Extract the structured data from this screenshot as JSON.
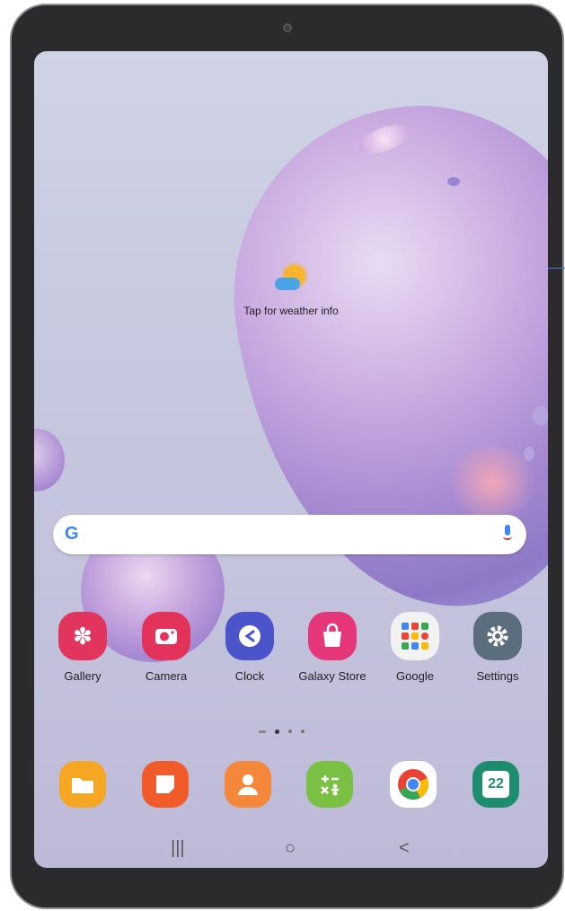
{
  "weather": {
    "label": "Tap for weather info",
    "icon": "partly-sunny-icon"
  },
  "search": {
    "logo": "G",
    "mic_icon": "mic-icon"
  },
  "apps": [
    {
      "label": "Gallery",
      "icon": "flower-icon",
      "color": "#e2355e"
    },
    {
      "label": "Camera",
      "icon": "camera-icon",
      "color": "#e3335b"
    },
    {
      "label": "Clock",
      "icon": "clock-icon",
      "color": "#4b54c8"
    },
    {
      "label": "Galaxy Store",
      "icon": "shopping-bag-icon",
      "color": "#e5367a"
    },
    {
      "label": "Google",
      "icon": "google-folder-icon",
      "color": "#f2f2f2"
    },
    {
      "label": "Settings",
      "icon": "gear-icon",
      "color": "#5a6e7d"
    }
  ],
  "dock": [
    {
      "icon": "folder-icon",
      "color": "#f5a623"
    },
    {
      "icon": "notes-icon",
      "color": "#f15b2a"
    },
    {
      "icon": "contacts-icon",
      "color": "#f5873a"
    },
    {
      "icon": "calculator-icon",
      "color": "#7ac143"
    },
    {
      "icon": "chrome-icon",
      "color": "#ffffff"
    },
    {
      "icon": "calendar-icon",
      "color": "#1e8c6e",
      "text": "22"
    }
  ],
  "navbar": {
    "recents": "|||",
    "home": "○",
    "back": "<"
  }
}
